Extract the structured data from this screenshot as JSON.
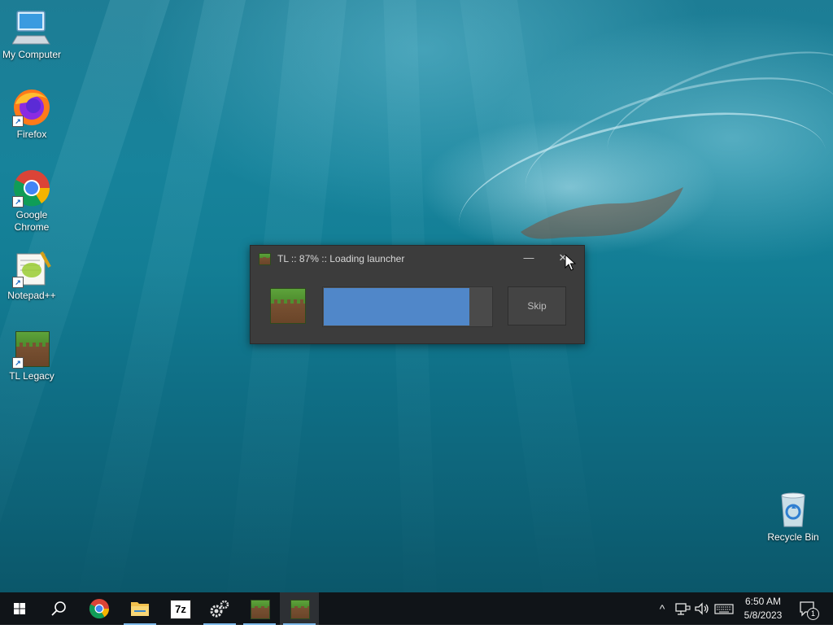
{
  "desktop": {
    "icons": [
      {
        "label": "My Computer"
      },
      {
        "label": "Firefox"
      },
      {
        "label": "Google Chrome"
      },
      {
        "label": "Notepad++"
      },
      {
        "label": "TL Legacy"
      },
      {
        "label": "Recycle Bin"
      }
    ]
  },
  "launcher": {
    "title": "TL :: 87% :: Loading launcher",
    "minimize_glyph": "—",
    "close_glyph": "✕",
    "progress": 0.87,
    "skip_label": "Skip",
    "accent_color": "#5087c9"
  },
  "taskbar": {
    "start_icon": "windows-logo-icon",
    "search_icon": "search-icon",
    "apps": [
      {
        "name": "chrome-icon"
      },
      {
        "name": "file-explorer-icon"
      },
      {
        "name": "7zip-icon",
        "glyph": "7z"
      },
      {
        "name": "settings-gears-icon"
      },
      {
        "name": "tl-legacy-icon"
      },
      {
        "name": "tl-launcher-icon",
        "active": true
      }
    ],
    "tray": {
      "chevron_glyph": "^",
      "network_icon": "network-icon",
      "volume_icon": "volume-icon",
      "keyboard_icon": "keyboard-icon",
      "time": "6:50 AM",
      "date": "5/8/2023",
      "notification_count": "1"
    }
  }
}
